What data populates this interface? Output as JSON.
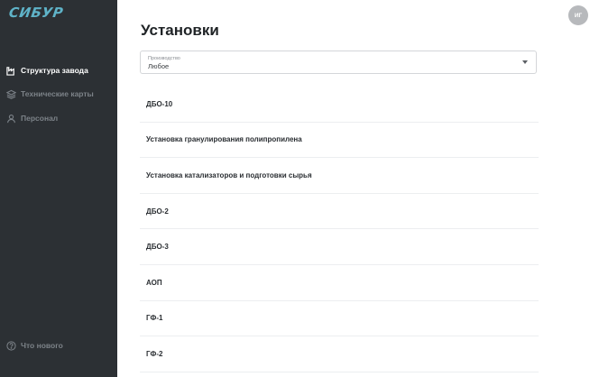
{
  "sidebar": {
    "logo": "СИБУР",
    "nav": [
      {
        "label": "Структура завода",
        "icon": "factory-icon",
        "active": true
      },
      {
        "label": "Технические карты",
        "icon": "layers-icon",
        "active": false
      },
      {
        "label": "Персонал",
        "icon": "person-icon",
        "active": false
      }
    ],
    "footer_item": {
      "label": "Что нового",
      "icon": "help-circle-icon"
    }
  },
  "header": {
    "avatar_initials": "ИГ"
  },
  "main": {
    "title": "Установки",
    "filter": {
      "label": "Производство",
      "value": "Любое"
    },
    "items": [
      "ДБО-10",
      "Установка гранулирования полипропилена",
      "Установка катализаторов и подготовки сырья",
      "ДБО-2",
      "ДБО-3",
      "АОП",
      "ГФ-1",
      "ГФ-2"
    ]
  },
  "colors": {
    "sidebar_bg": "#2c3034",
    "logo": "#5fb3c8",
    "nav_active": "#ffffff",
    "nav_inactive": "#7c8288",
    "avatar_bg": "#b7b9bc"
  }
}
